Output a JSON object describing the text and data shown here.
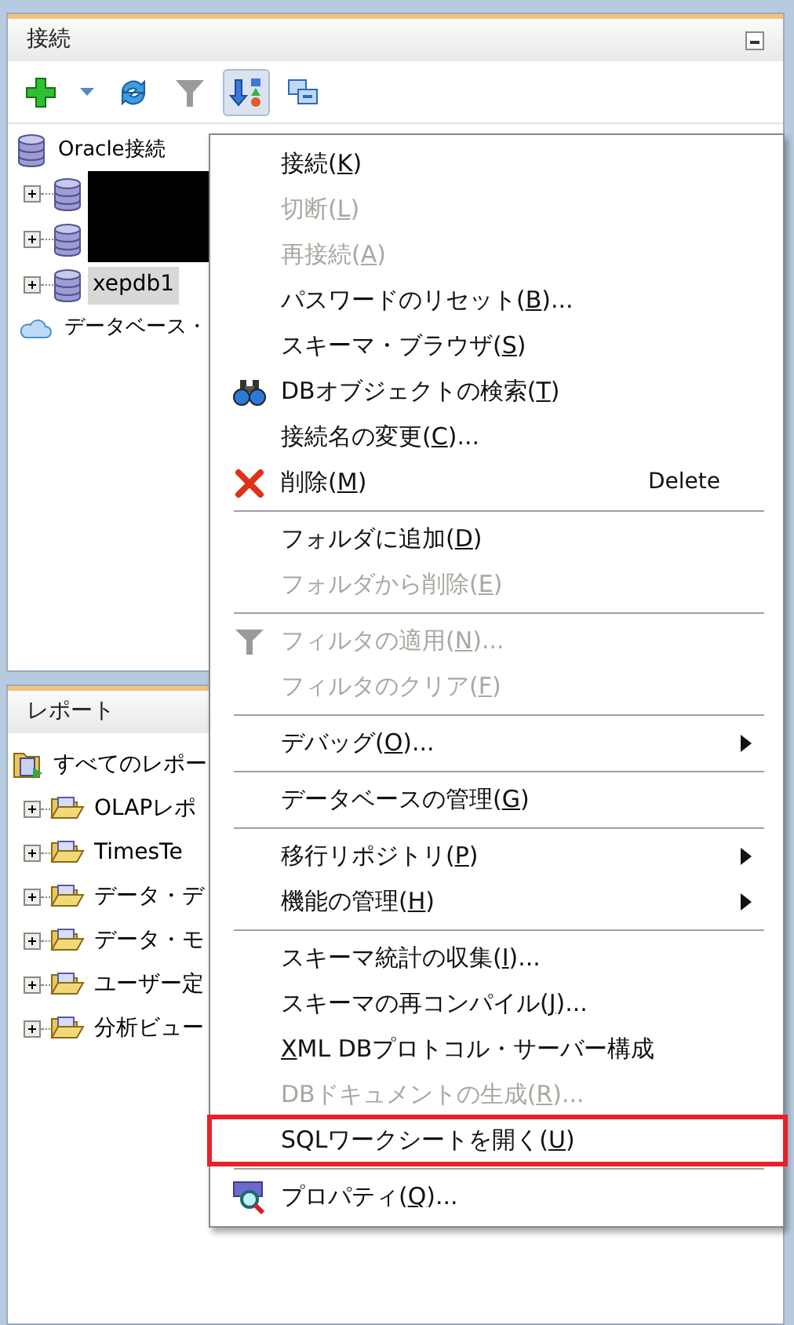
{
  "connections_panel": {
    "title": "接続",
    "toolbar": [
      {
        "selected": false
      },
      {
        "selected": false
      },
      {
        "selected": false
      },
      {
        "selected": false
      },
      {
        "selected": true
      },
      {
        "selected": false
      }
    ],
    "tree": [
      {
        "label": "Oracle接続",
        "kind": "root",
        "selected": false,
        "children": [
          {
            "redacted": true
          },
          {
            "redacted": true
          },
          {
            "label": "xepdb1",
            "redacted": false,
            "selected": true
          }
        ]
      },
      {
        "label": "データベース・",
        "kind": "cloud",
        "selected": false
      }
    ]
  },
  "reports_panel": {
    "title": "レポート",
    "tree": [
      {
        "label": "すべてのレポー",
        "kind": "reports",
        "children": [
          {
            "label": "OLAPレポ"
          },
          {
            "label": "TimesTe"
          },
          {
            "label": "データ・デ"
          },
          {
            "label": "データ・モ"
          },
          {
            "label": "ユーザー定"
          },
          {
            "label": "分析ビュー"
          }
        ]
      }
    ]
  },
  "context_menu": [
    {
      "kind": "item",
      "before": "接続(",
      "key": "K",
      "after": ")",
      "disabled": false
    },
    {
      "kind": "item",
      "before": "切断(",
      "key": "L",
      "after": ")",
      "disabled": true
    },
    {
      "kind": "item",
      "before": "再接続(",
      "key": "A",
      "after": ")",
      "disabled": true
    },
    {
      "kind": "item",
      "before": "パスワードのリセット(",
      "key": "B",
      "after": ")...",
      "disabled": false
    },
    {
      "kind": "item",
      "before": "スキーマ・ブラウザ(",
      "key": "S",
      "after": ")",
      "disabled": false
    },
    {
      "kind": "item",
      "before": "DBオブジェクトの検索(",
      "key": "T",
      "after": ")",
      "disabled": false
    },
    {
      "kind": "item",
      "before": "接続名の変更(",
      "key": "C",
      "after": ")...",
      "disabled": false
    },
    {
      "kind": "item",
      "before": "削除(",
      "key": "M",
      "after": ")",
      "shortcut": "Delete",
      "disabled": false
    },
    {
      "kind": "separator"
    },
    {
      "kind": "item",
      "before": "フォルダに追加(",
      "key": "D",
      "after": ")",
      "disabled": false
    },
    {
      "kind": "item",
      "before": "フォルダから削除(",
      "key": "E",
      "after": ")",
      "disabled": true
    },
    {
      "kind": "separator"
    },
    {
      "kind": "item",
      "before": "フィルタの適用(",
      "key": "N",
      "after": ")...",
      "disabled": true
    },
    {
      "kind": "item",
      "before": "フィルタのクリア(",
      "key": "F",
      "after": ")",
      "disabled": true
    },
    {
      "kind": "separator"
    },
    {
      "kind": "item",
      "before": "デバッグ(",
      "key": "O",
      "after": ")...",
      "submenu": true,
      "disabled": false
    },
    {
      "kind": "separator"
    },
    {
      "kind": "item",
      "before": "データベースの管理(",
      "key": "G",
      "after": ")",
      "disabled": false
    },
    {
      "kind": "separator"
    },
    {
      "kind": "item",
      "before": "移行リポジトリ(",
      "key": "P",
      "after": ")",
      "submenu": true,
      "disabled": false
    },
    {
      "kind": "item",
      "before": "機能の管理(",
      "key": "H",
      "after": ")",
      "submenu": true,
      "disabled": false
    },
    {
      "kind": "separator"
    },
    {
      "kind": "item",
      "before": "スキーマ統計の収集(",
      "key": "I",
      "after": ")...",
      "disabled": false
    },
    {
      "kind": "item",
      "before": "スキーマの再コンパイル(",
      "key": "J",
      "after": ")...",
      "disabled": false
    },
    {
      "kind": "item",
      "key": "X",
      "after": "ML DBプロトコル・サーバー構成",
      "disabled": false
    },
    {
      "kind": "item",
      "before": "DBドキュメントの生成(",
      "key": "R",
      "after": ")...",
      "disabled": true
    },
    {
      "kind": "item",
      "before": "SQLワークシートを開く(",
      "key": "U",
      "after": ")",
      "disabled": false,
      "outlined": true
    },
    {
      "kind": "separator"
    },
    {
      "kind": "item",
      "before": "プロパティ(",
      "key": "Q",
      "after": ")...",
      "disabled": false
    }
  ]
}
